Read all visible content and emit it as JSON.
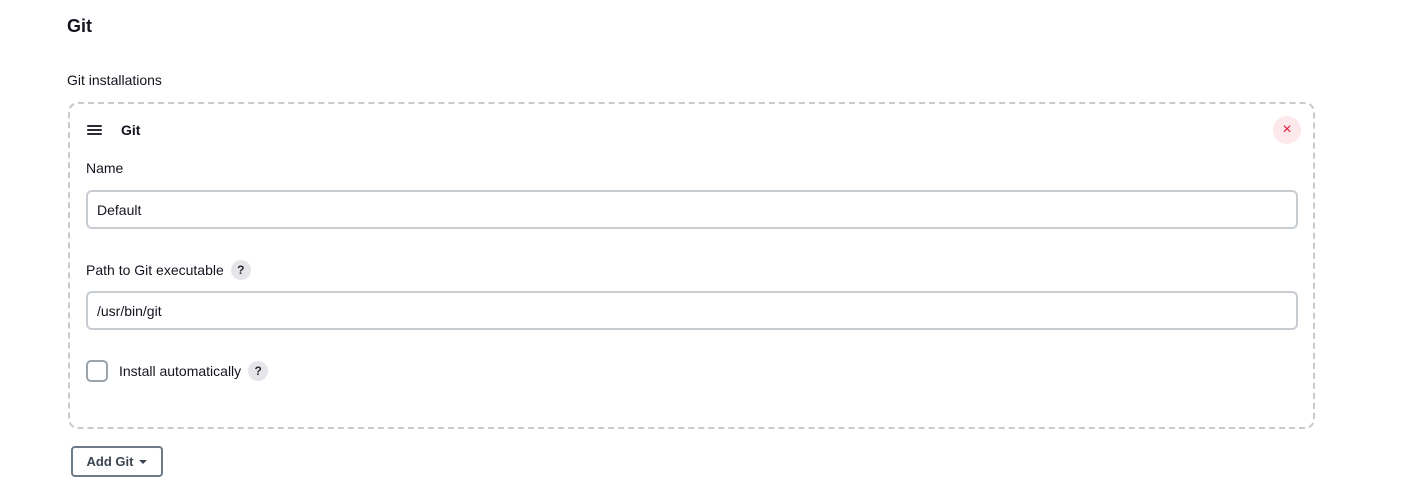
{
  "section": {
    "title": "Git",
    "installations_label": "Git installations"
  },
  "installation": {
    "title": "Git",
    "delete_icon": "×",
    "name_label": "Name",
    "name_value": "Default",
    "path_label": "Path to Git executable",
    "path_value": "/usr/bin/git",
    "help_glyph": "?",
    "install_auto_label": "Install automatically",
    "install_auto_checked": false
  },
  "add_button": {
    "label": "Add Git"
  },
  "colors": {
    "delete_bg": "#fde8ec",
    "delete_fg": "#e3163b",
    "input_border": "#c7ccd1",
    "card_border": "#c9c9cf"
  }
}
